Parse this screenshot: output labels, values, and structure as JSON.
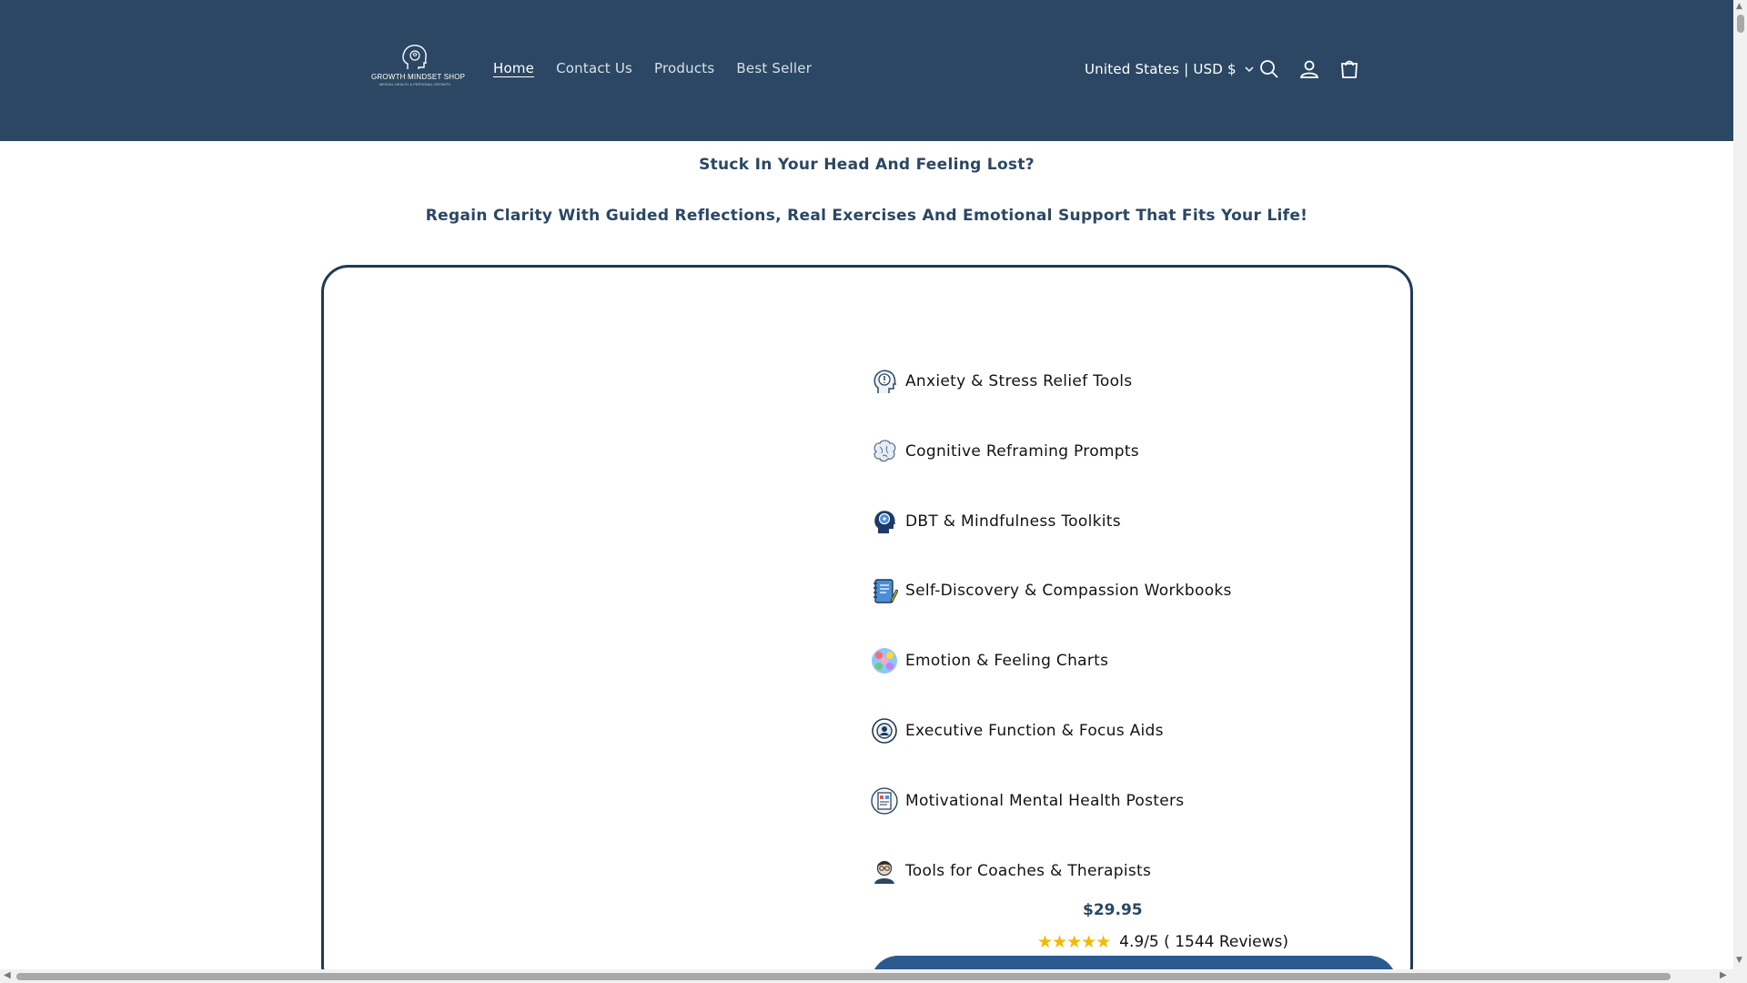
{
  "header": {
    "logo": {
      "name": "GROWTH MINDSET SHOP",
      "tagline": "MENTAL HEALTH & PERSONAL GROWTH"
    },
    "nav": [
      {
        "label": "Home",
        "active": true
      },
      {
        "label": "Contact Us"
      },
      {
        "label": "Products"
      },
      {
        "label": "Best Seller"
      }
    ],
    "locale": "United States | USD $",
    "icons": [
      "search-icon",
      "account-icon",
      "cart-icon"
    ]
  },
  "hero": {
    "headline": "Stuck In Your Head And Feeling Lost?",
    "subheadline": "Regain Clarity With Guided Reflections, Real Exercises And Emotional Support That Fits Your Life!"
  },
  "product": {
    "features": [
      {
        "label": "Anxiety & Stress Relief Tools",
        "icon": "anxiety-head-icon"
      },
      {
        "label": "Cognitive Reframing Prompts",
        "icon": "brain-icon"
      },
      {
        "label": "DBT & Mindfulness Toolkits",
        "icon": "mindful-head-icon"
      },
      {
        "label": "Self-Discovery & Compassion Workbooks",
        "icon": "notebook-icon"
      },
      {
        "label": "Emotion & Feeling Charts",
        "icon": "emotions-chart-icon"
      },
      {
        "label": "Executive Function & Focus Aids",
        "icon": "focus-target-icon"
      },
      {
        "label": "Motivational Mental Health Posters",
        "icon": "poster-icon"
      },
      {
        "label": "Tools for Coaches & Therapists",
        "icon": "therapist-icon"
      }
    ],
    "price": "$29.95",
    "rating_value": 5,
    "rating_text": "4.9/5 ( 1544 Reviews)"
  },
  "colors": {
    "header_bg": "#2b4763",
    "accent": "#2b4763",
    "card_border": "#1f3a55",
    "star": "#f5b800",
    "cta": "#2b5a8f"
  }
}
